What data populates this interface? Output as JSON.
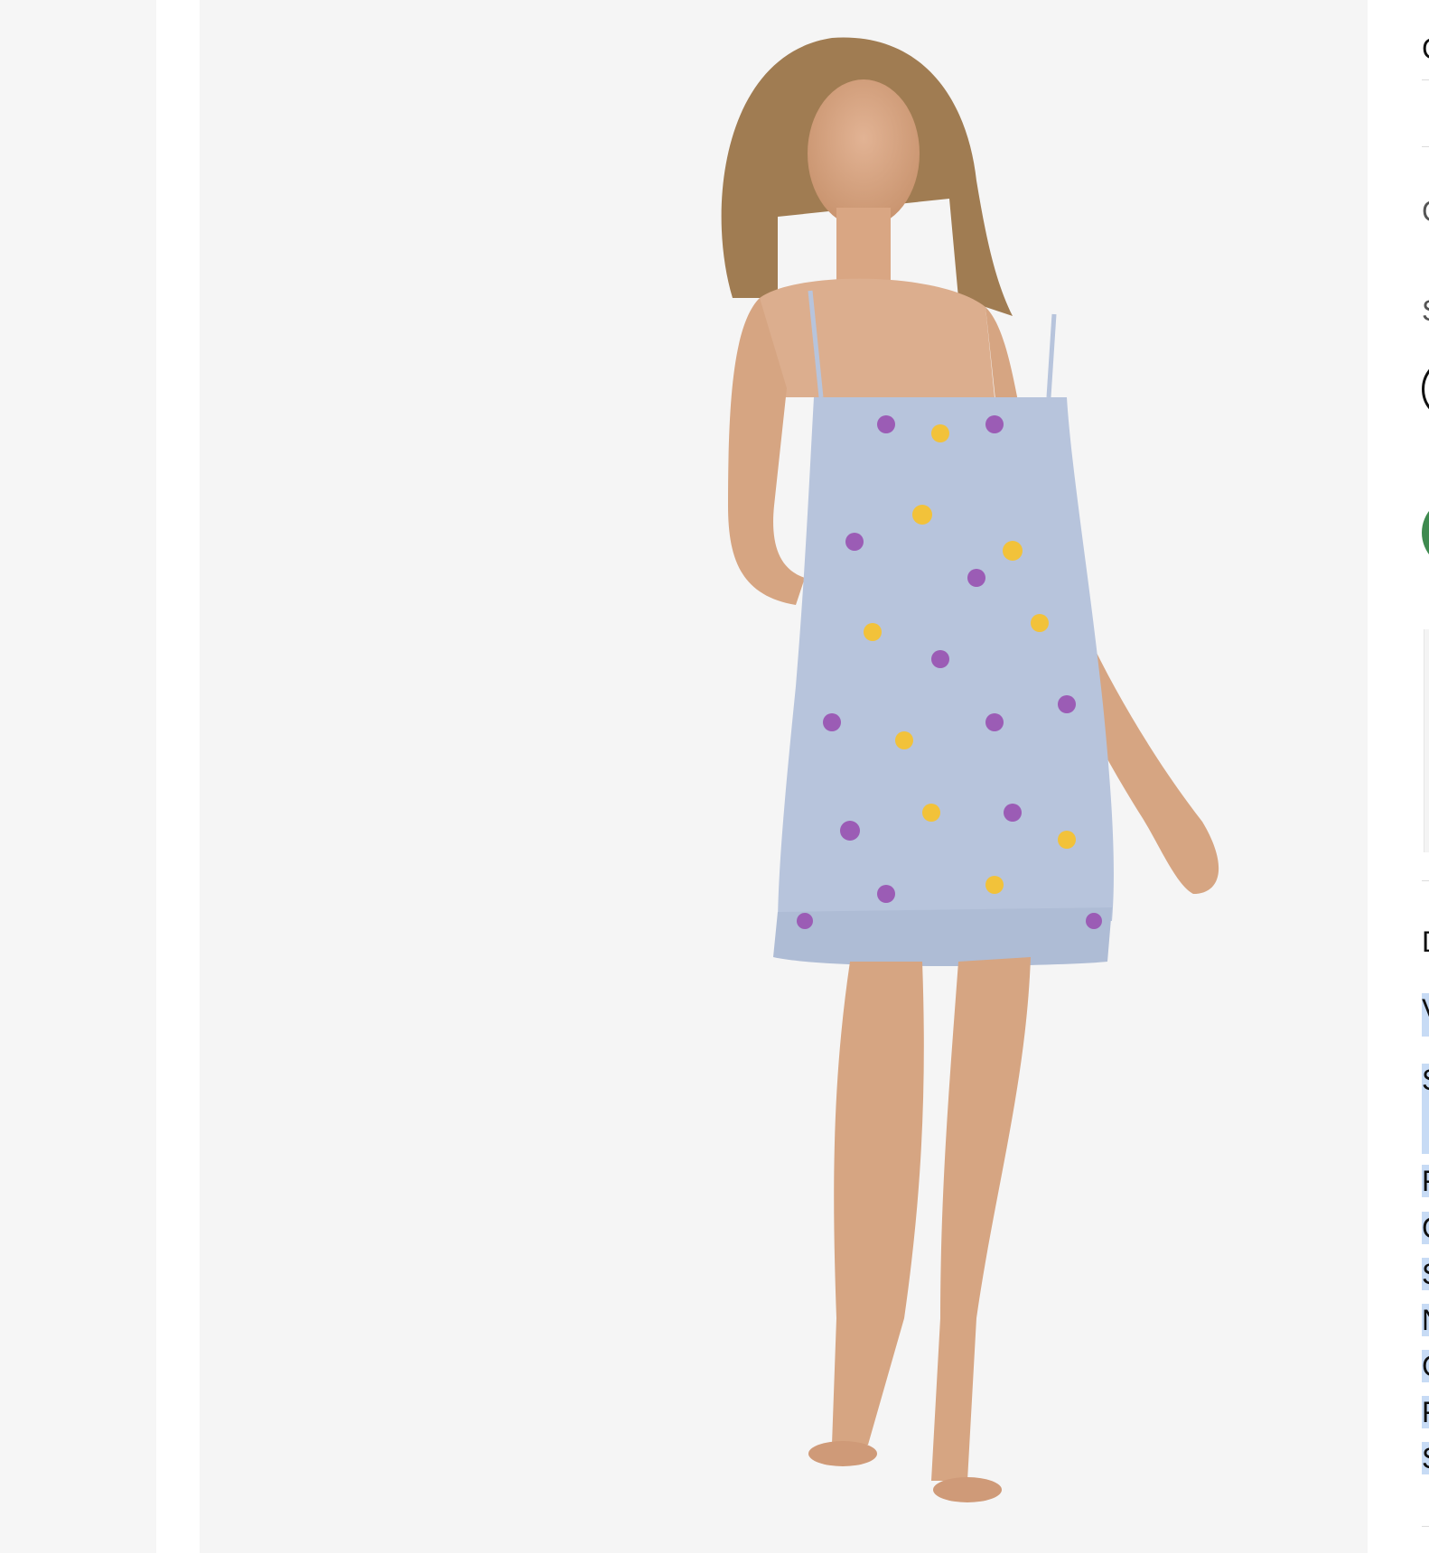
{
  "gallery": {
    "image_alt": "Model wearing a light blue floral mini slip dress with ruffle hem"
  },
  "info": {
    "line_1": "C",
    "line_2": "C",
    "line_3": "S",
    "line_4": "D",
    "line_5": "V",
    "line_6": "S",
    "line_7": "F",
    "line_8": "C",
    "line_9": "S",
    "line_10": "N",
    "line_11": "C",
    "line_12": "F",
    "line_13": "S"
  },
  "colors": {
    "dress": "#b7c4dc",
    "swatch_green": "#3e8a4f",
    "highlight": "#c7dbf5"
  }
}
